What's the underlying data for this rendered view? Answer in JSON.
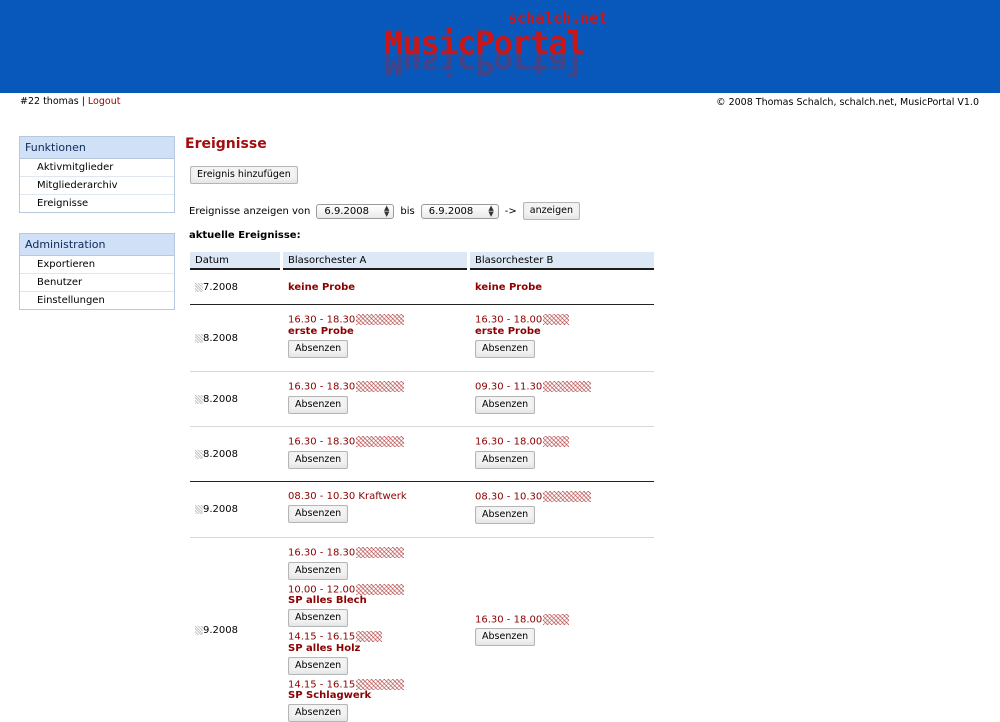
{
  "header": {
    "logo_sub": "schalch.net",
    "logo_main": "MusicPortal"
  },
  "userbar": {
    "user": "#22 thomas",
    "separator": "|",
    "logout": "Logout"
  },
  "copyright": "© 2008 Thomas Schalch, schalch.net, MusicPortal V1.0",
  "sidebar": {
    "functions": {
      "title": "Funktionen",
      "items": [
        "Aktivmitglieder",
        "Mitgliederarchiv",
        "Ereignisse"
      ]
    },
    "administration": {
      "title": "Administration",
      "items": [
        "Exportieren",
        "Benutzer",
        "Einstellungen"
      ]
    }
  },
  "main": {
    "title": "Ereignisse",
    "add_button": "Ereignis hinzufügen",
    "filter": {
      "label": "Ereignisse anzeigen von",
      "from": "6.9.2008",
      "bis": "bis",
      "to": "6.9.2008",
      "arrow": "->",
      "button": "anzeigen"
    },
    "section": "aktuelle Ereignisse:",
    "table": {
      "headers": [
        "Datum",
        "Blasorchester A",
        "Blasorchester B"
      ],
      "absent_label": "Absenzen",
      "rows": [
        {
          "date": "7.2008",
          "a_text": "keine Probe",
          "b_text": "keine Probe"
        },
        {
          "date": "8.2008",
          "a_time": "16.30 - 18.30",
          "a_note": "erste Probe",
          "b_time": "16.30 - 18.00",
          "b_note": "erste Probe"
        },
        {
          "date": "8.2008",
          "a_time": "16.30 - 18.30",
          "b_time": "09.30 - 11.30"
        },
        {
          "date": "8.2008",
          "a_time": "16.30 - 18.30",
          "b_time": "16.30 - 18.00"
        },
        {
          "date": "9.2008",
          "a_time": "08.30 - 10.30 Kraftwerk",
          "b_time": "08.30 - 10.30"
        },
        {
          "date": "9.2008",
          "a_events": [
            {
              "time": "16.30 - 18.30",
              "note": ""
            },
            {
              "time": "10.00 - 12.00",
              "note": "SP alles Blech"
            },
            {
              "time": "14.15 - 16.15",
              "note": "SP alles Holz"
            },
            {
              "time": "14.15 - 16.15",
              "note": "SP Schlagwerk"
            }
          ],
          "b_time": "16.30 - 18.00"
        }
      ]
    }
  },
  "colors": {
    "header_bg": "#0857bb",
    "accent_red": "#a30d0d",
    "menu_head_bg": "#cfe0f7",
    "table_head_bg": "#dce8f6"
  }
}
